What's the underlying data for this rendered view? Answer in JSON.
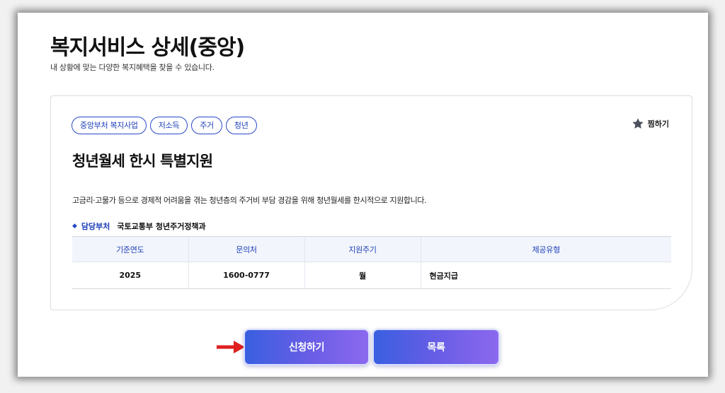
{
  "page": {
    "title": "복지서비스 상세(중앙)",
    "subtitle": "내 상황에 맞는 다양한 복지혜택을 찾을 수 있습니다."
  },
  "service": {
    "tags": [
      "중앙부처 복지사업",
      "저소득",
      "주거",
      "청년"
    ],
    "favorite_label": "찜하기",
    "title": "청년월세 한시 특별지원",
    "description": "고금리·고물가 등으로 경제적 어려움을 겪는 청년층의 주거비 부담 경감을 위해 청년월세를 한시적으로 지원합니다.",
    "department_label": "담당부처",
    "department_value": "국토교통부 청년주거정책과",
    "table": {
      "headers": [
        "기준연도",
        "문의처",
        "지원주기",
        "제공유형"
      ],
      "row": [
        "2025",
        "1600-0777",
        "월",
        "현금지급"
      ]
    }
  },
  "buttons": {
    "apply_label": "신청하기",
    "list_label": "목록"
  },
  "colors": {
    "accent": "#1d3fb8",
    "button_gradient_start": "#3a5fe0",
    "button_gradient_end": "#8b69ee",
    "arrow": "#e02020"
  },
  "icons": {
    "favorite": "star-icon",
    "pointer": "arrow-right-icon"
  }
}
